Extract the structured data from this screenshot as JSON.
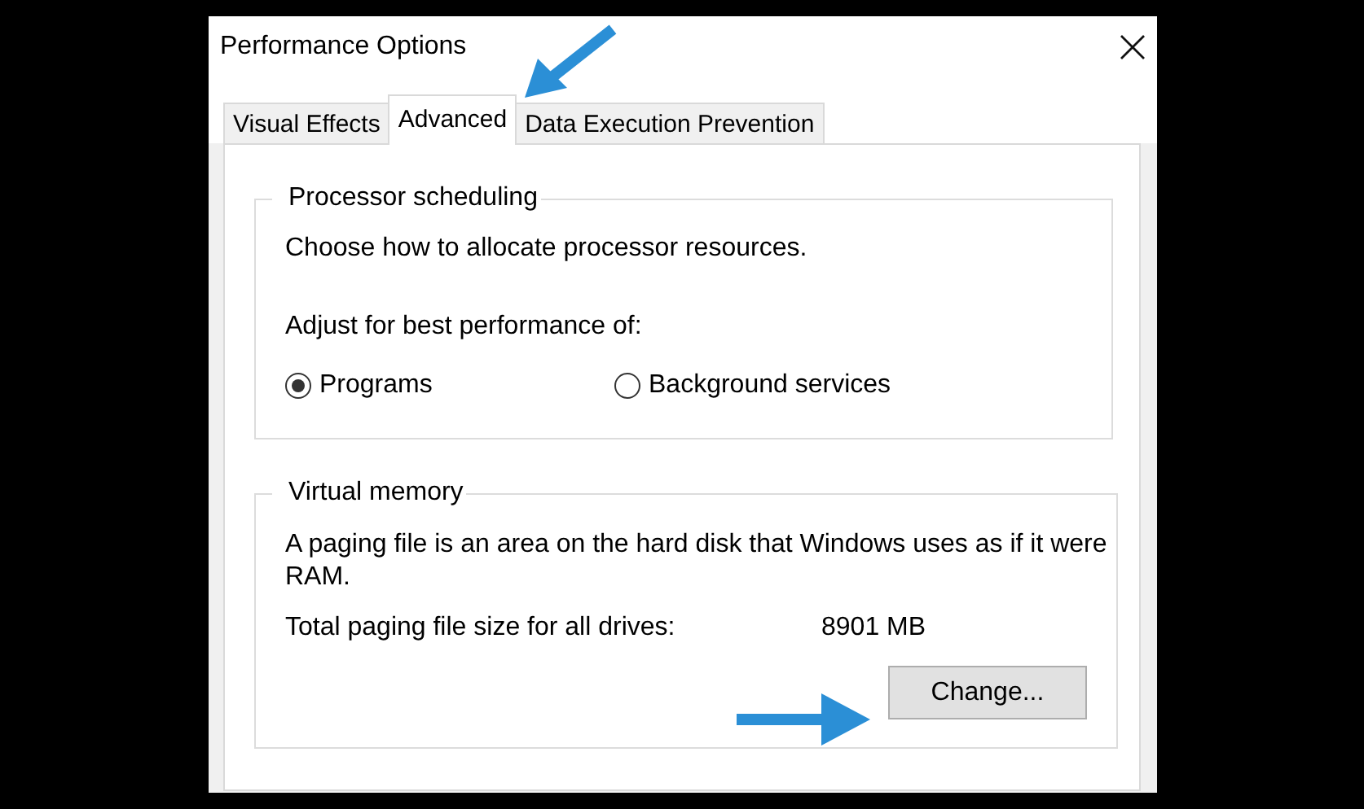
{
  "window": {
    "title": "Performance Options"
  },
  "tabs": [
    {
      "label": "Visual Effects",
      "selected": false
    },
    {
      "label": "Advanced",
      "selected": true
    },
    {
      "label": "Data Execution Prevention",
      "selected": false
    }
  ],
  "processor_scheduling": {
    "title": "Processor scheduling",
    "description": "Choose how to allocate processor resources.",
    "prompt": "Adjust for best performance of:",
    "options": [
      {
        "label": "Programs",
        "selected": true
      },
      {
        "label": "Background services",
        "selected": false
      }
    ]
  },
  "virtual_memory": {
    "title": "Virtual memory",
    "description": "A paging file is an area on the hard disk that Windows uses as if it were RAM.",
    "total_label": "Total paging file size for all drives:",
    "total_value": "8901 MB",
    "button": "Change..."
  }
}
